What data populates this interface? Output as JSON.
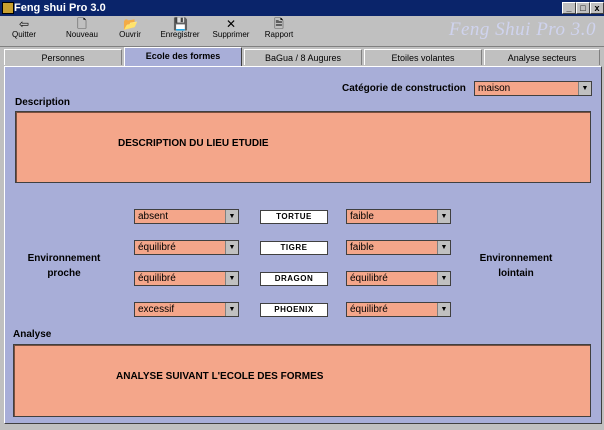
{
  "window": {
    "title": "Feng shui Pro 3.0",
    "minimize": "_",
    "maximize": "□",
    "close": "x"
  },
  "toolbar": {
    "items": [
      {
        "label": "Quitter",
        "icon": "arrow-back-icon",
        "glyph": "⇦"
      },
      {
        "label": "Nouveau",
        "icon": "new-document-icon",
        "glyph": "🗋"
      },
      {
        "label": "Ouvrir",
        "icon": "open-folder-icon",
        "glyph": "📂"
      },
      {
        "label": "Enregistrer",
        "icon": "save-disk-icon",
        "glyph": "💾"
      },
      {
        "label": "Supprimer",
        "icon": "delete-icon",
        "glyph": "✕"
      },
      {
        "label": "Rapport",
        "icon": "report-icon",
        "glyph": "🗎"
      }
    ],
    "brand": "Feng Shui Pro 3.0"
  },
  "tabs": [
    "Personnes",
    "Ecole des formes",
    "BaGua / 8 Augures",
    "Etoiles volantes",
    "Analyse secteurs"
  ],
  "form": {
    "category_label": "Catégorie de construction",
    "category_value": "maison",
    "description_label": "Description",
    "description_text": "DESCRIPTION DU LIEU ETUDIE",
    "env_near_label": "Environnement proche",
    "env_far_label": "Environnement lointain",
    "rows": [
      {
        "animal": "TORTUE",
        "near": "absent",
        "far": "faible"
      },
      {
        "animal": "TIGRE",
        "near": "équilibré",
        "far": "faible"
      },
      {
        "animal": "DRAGON",
        "near": "équilibré",
        "far": "équilibré"
      },
      {
        "animal": "PHOENIX",
        "near": "excessif",
        "far": "équilibré"
      }
    ],
    "analysis_label": "Analyse",
    "analysis_text": "ANALYSE SUIVANT L'ECOLE DES FORMES"
  },
  "colors": {
    "panel": "#a8aed8",
    "field": "#f4a68a",
    "titlebar": "#0a246a"
  }
}
